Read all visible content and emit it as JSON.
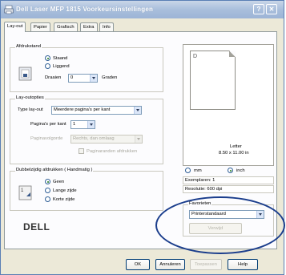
{
  "window": {
    "title": "Dell Laser MFP 1815 Voorkeursinstellingen",
    "help_glyph": "?",
    "close_glyph": "✕"
  },
  "tabs": [
    "Lay-out",
    "Papier",
    "Grafisch",
    "Extra",
    "Info"
  ],
  "orientation": {
    "label": "Afdrukstand",
    "options": [
      "Staand",
      "Liggend"
    ],
    "selected": "Staand",
    "rotate_label": "Draaien",
    "rotate_value": "0",
    "rotate_unit": "Graden"
  },
  "layout": {
    "label": "Lay-outopties",
    "type_label": "Type lay-out",
    "type_value": "Meerdere pagina's per kant",
    "pages_label": "Pagina's per kant",
    "pages_value": "1",
    "order_label": "Paginavolgorde",
    "order_value": "Rechts, dan omlaag",
    "border_label": "Paginaranden afdrukken"
  },
  "duplex": {
    "label": "Dubbelzijdig afdrukken ( Handmatig )",
    "options": [
      "Geen",
      "Lange zijde",
      "Korte zijde"
    ],
    "selected": "Geen"
  },
  "preview": {
    "page_letter": "D",
    "paper_name": "Letter",
    "paper_size": "8.50 x 11.00 in",
    "unit_options": [
      "mm",
      "inch"
    ],
    "unit_selected": "inch",
    "copies": "Exemplaren: 1",
    "resolution": "Resolutie: 600 dpi"
  },
  "favorites": {
    "label": "Favorieten",
    "value": "Printerstandaard",
    "delete_label": "Verwijd"
  },
  "brand": "DELL",
  "footer": {
    "ok": "OK",
    "cancel": "Annuleren",
    "apply": "Toepassen",
    "help": "Help"
  }
}
